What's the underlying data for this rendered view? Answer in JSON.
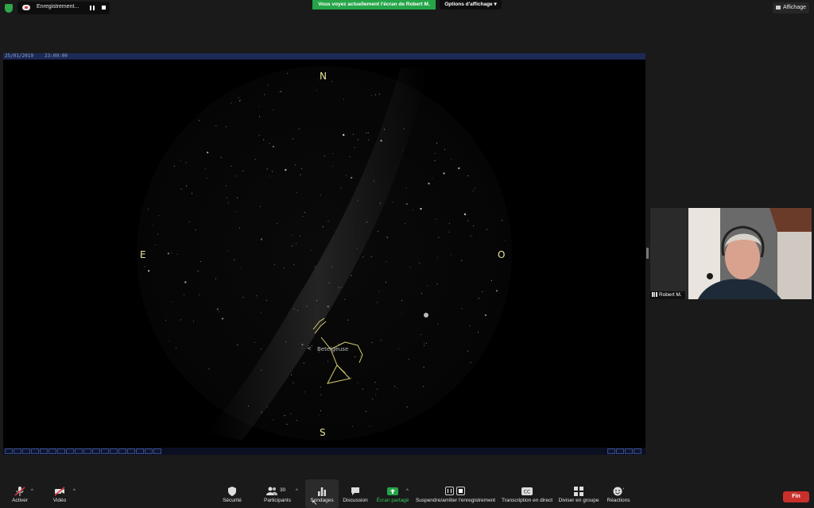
{
  "top_bar": {
    "recording_label": "Enregistrement...",
    "share_banner": "Vous voyez actuellement l'écran de Robert M.",
    "view_options": "Options d'affichage",
    "view_button": "Affichage"
  },
  "shared_screen": {
    "date": "25/01/2019",
    "time": "23:00:00",
    "cardinals": {
      "north": "N",
      "east": "E",
      "west": "O",
      "south": "S"
    },
    "star_label": "Betelgeuse",
    "star_label_marker": "<"
  },
  "participant": {
    "name": "Robert M."
  },
  "controls": {
    "unmute": "Activer",
    "video": "Vidéo",
    "security": "Sécurité",
    "participants": "Participants",
    "participants_count": "30",
    "polls": "Sondages",
    "chat": "Discussion",
    "share_screen": "Écran partagé",
    "recording": "Suspendre/arrêter l'enregistrement",
    "transcription": "Transcription en direct",
    "breakout": "Diviser en groupe",
    "reactions": "Réactions",
    "end": "Fin"
  },
  "colors": {
    "share_green": "#25a548",
    "end_red": "#c9302c",
    "constellation": "#d6cf6a",
    "bar_blue": "#1c2a55"
  }
}
